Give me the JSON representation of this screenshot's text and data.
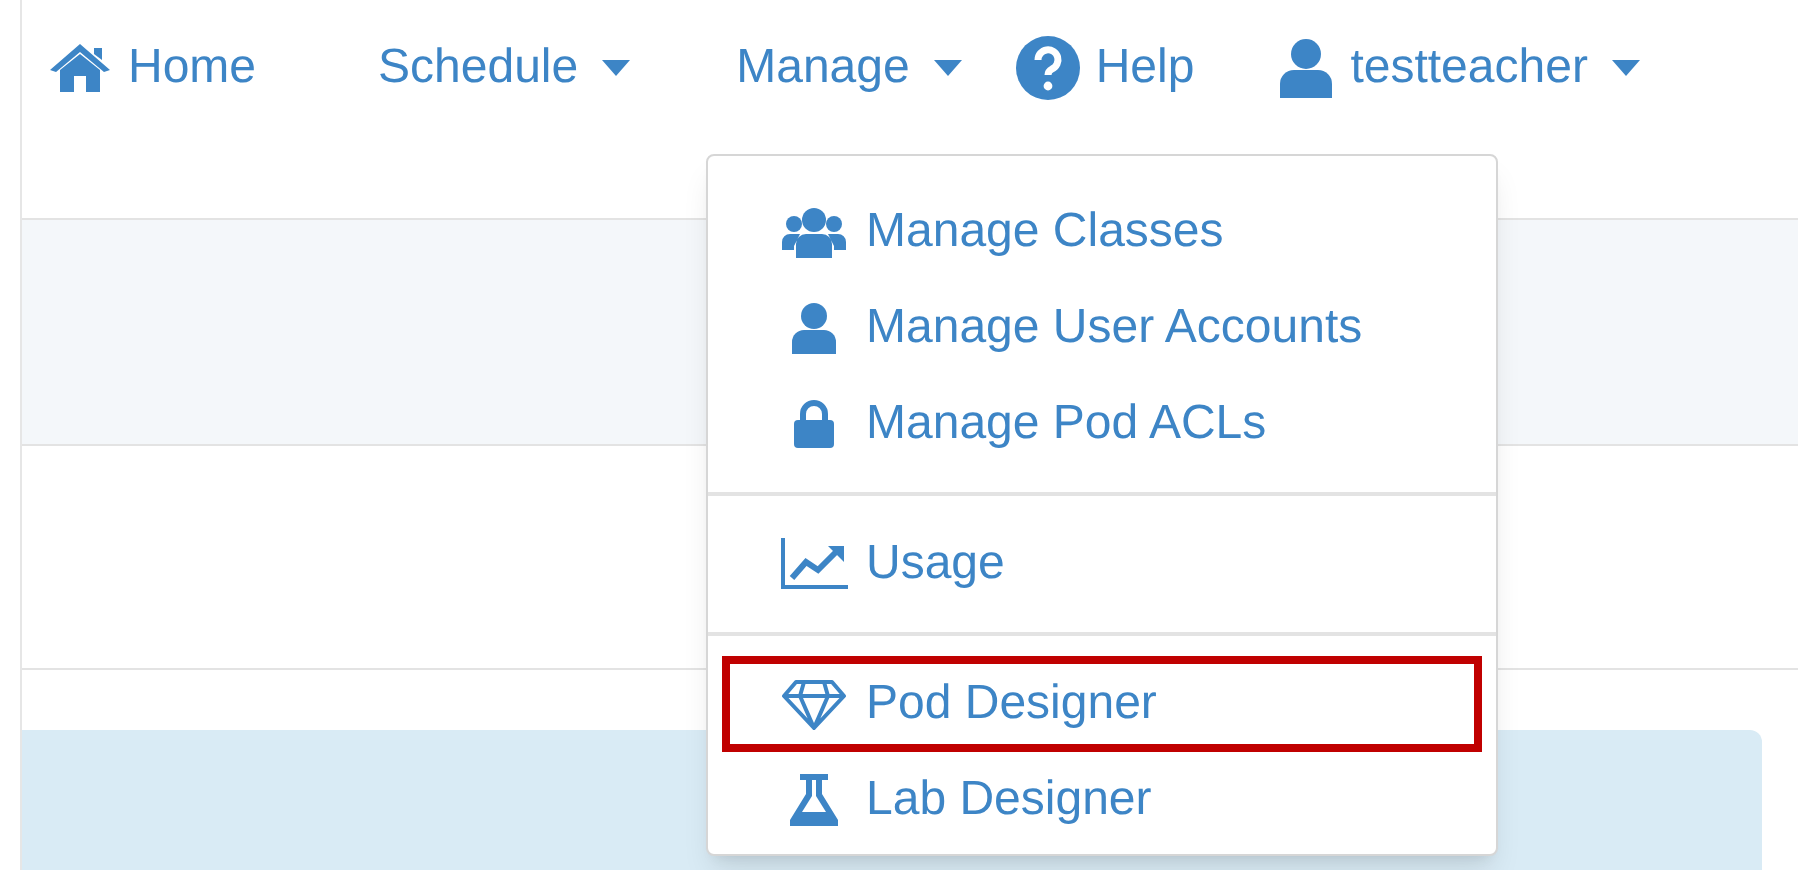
{
  "nav": [
    {
      "label": "Home",
      "dropdown": false
    },
    {
      "label": "Schedule",
      "dropdown": true
    },
    {
      "label": "Manage",
      "dropdown": true
    },
    {
      "label": "Help",
      "dropdown": false
    },
    {
      "label": "testteacher",
      "dropdown": true
    }
  ],
  "menu": {
    "groups": [
      {
        "items": [
          {
            "label": "Manage Classes",
            "highlighted": false
          },
          {
            "label": "Manage User Accounts",
            "highlighted": false
          },
          {
            "label": "Manage Pod ACLs",
            "highlighted": false
          }
        ]
      },
      {
        "items": [
          {
            "label": "Usage",
            "highlighted": false
          }
        ]
      },
      {
        "items": [
          {
            "label": "Pod Designer",
            "highlighted": true
          },
          {
            "label": "Lab Designer",
            "highlighted": false
          }
        ]
      }
    ]
  }
}
